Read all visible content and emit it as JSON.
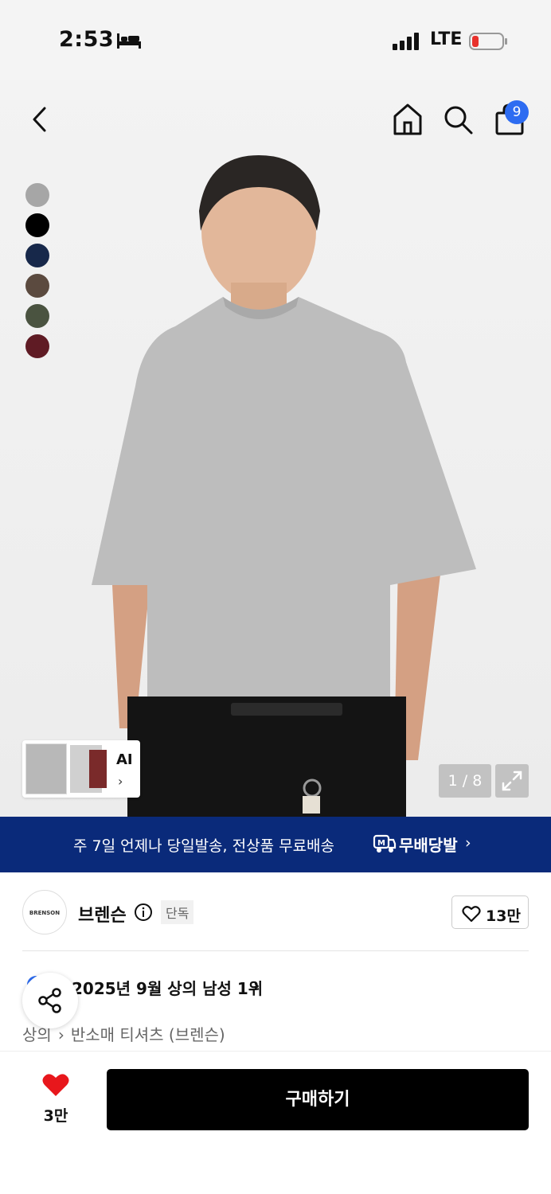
{
  "status_bar": {
    "time": "2:53",
    "network": "LTE"
  },
  "header": {
    "cart_badge": "9"
  },
  "swatches": [
    "#a6a6a6",
    "#000000",
    "#17284a",
    "#5b4a3f",
    "#4a5340",
    "#5f1b24"
  ],
  "gallery": {
    "ai_label": "AI",
    "counter": "1 / 8"
  },
  "banner": {
    "text": "주 7일 언제나 당일발송, 전상품 무료배송",
    "brand": "무배당발",
    "background": "#0a2a7a"
  },
  "brand": {
    "logo_text": "BRENSON",
    "name": "브렌슨",
    "tag": "단독",
    "likes": "13만"
  },
  "ranking": {
    "text": "2025년 9월 상의 남성 1위"
  },
  "category": {
    "level1": "상의",
    "level2": "반소매 티셔츠 (브렌슨)"
  },
  "bottom_bar": {
    "favorite_count": "3만",
    "buy_label": "구매하기",
    "heart_color": "#e8171c"
  }
}
